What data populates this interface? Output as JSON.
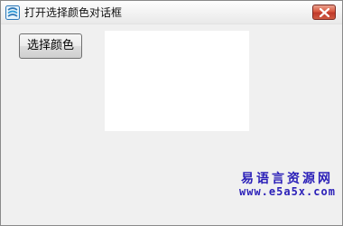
{
  "window": {
    "title": "打开选择颜色对话框",
    "icon": "app-logo-icon",
    "close_icon": "close-icon"
  },
  "content": {
    "choose_button_label": "选择颜色",
    "color_preview": {
      "color": "#ffffff"
    }
  },
  "watermark": {
    "site_name": "易语言资源网",
    "url": "www.e5a5x.com",
    "color": "#2a1fb8"
  },
  "colors": {
    "window_bg": "#f0f0f0",
    "close_button": "#c0392b"
  }
}
